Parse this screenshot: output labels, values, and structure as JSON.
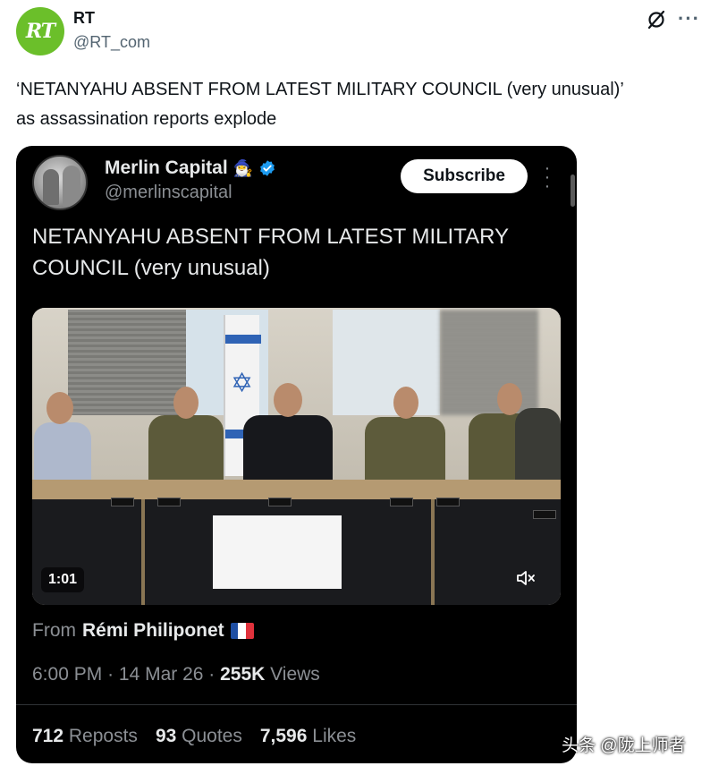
{
  "author": {
    "name": "RT",
    "handle": "@RT_com",
    "avatar_text": "RT",
    "avatar_color": "#6bbf2a"
  },
  "header_icons": {
    "grok": "grok-slash-icon",
    "more": "more-icon"
  },
  "tweet_text": {
    "line1": "‘NETANYAHU ABSENT FROM LATEST MILITARY COUNCIL (very unusual)’",
    "line2": "as assassination reports explode"
  },
  "quoted": {
    "name": "Merlin Capital",
    "name_emoji": "🧙‍♂️",
    "handle": "@merlinscapital",
    "subscribe_label": "Subscribe",
    "text": "NETANYAHU ABSENT FROM LATEST MILITARY COUNCIL (very unusual)",
    "video": {
      "duration": "1:01",
      "muted": true
    },
    "from_label": "From",
    "from_name": "Rémi Philiponet",
    "from_flag": "🇫🇷",
    "time": "6:00 PM",
    "date": "14 Mar 26",
    "views_count": "255K",
    "views_label": "Views",
    "reposts_count": "712",
    "reposts_label": "Reposts",
    "quotes_count": "93",
    "quotes_label": "Quotes",
    "likes_count": "7,596",
    "likes_label": "Likes"
  },
  "watermark": "头条 @陇上师者"
}
